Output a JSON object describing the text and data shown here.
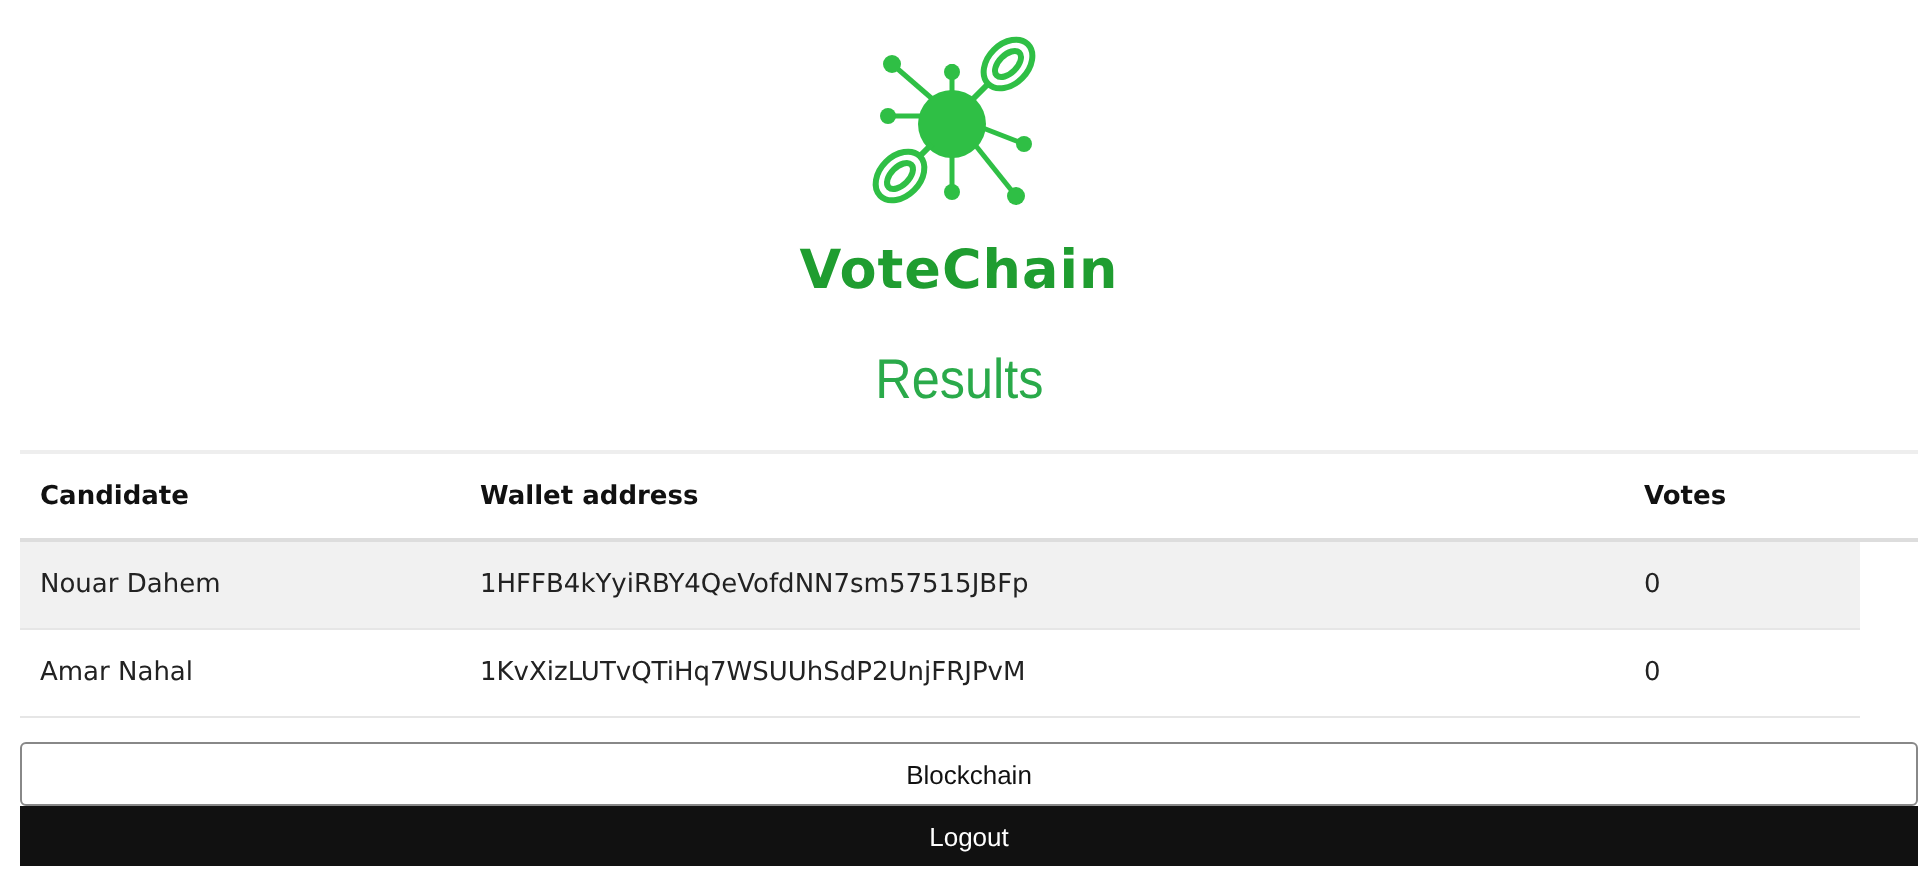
{
  "brand": {
    "name": "VoteChain"
  },
  "page_title": "Results",
  "table": {
    "columns": [
      "Candidate",
      "Wallet address",
      "Votes"
    ],
    "rows": [
      {
        "candidate": "Nouar Dahem",
        "wallet": "1HFFB4kYyiRBY4QeVofdNN7sm57515JBFp",
        "votes": "0",
        "highlighted": true
      },
      {
        "candidate": "Amar Nahal",
        "wallet": "1KvXizLUTvQTiHq7WSUUhSdP2UnjFRJPvM",
        "votes": "0",
        "highlighted": false
      }
    ]
  },
  "buttons": [
    {
      "label": "Blockchain",
      "kind": "outline"
    },
    {
      "label": "Logout",
      "kind": "dark"
    }
  ]
}
